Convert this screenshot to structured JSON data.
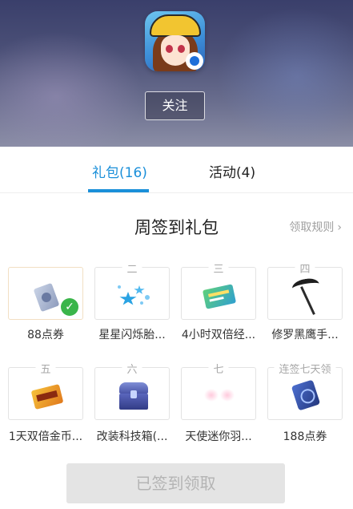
{
  "header": {
    "app_icon": "game-app-icon",
    "follow_label": "关注"
  },
  "tabs": [
    {
      "label": "礼包(16)",
      "active": true
    },
    {
      "label": "活动(4)",
      "active": false
    }
  ],
  "section": {
    "title": "周签到礼包",
    "rules_label": "领取规则",
    "rules_icon": "chevron-right-icon"
  },
  "gifts": [
    {
      "day": "",
      "name": "88点券",
      "icon": "coupon-icon",
      "claimed": true
    },
    {
      "day": "二",
      "name": "星星闪烁胎...",
      "icon": "stars-icon",
      "claimed": false
    },
    {
      "day": "三",
      "name": "4小时双倍经...",
      "icon": "ticket-icon",
      "claimed": false
    },
    {
      "day": "四",
      "name": "修罗黑鹰手...",
      "icon": "scythe-icon",
      "claimed": false
    },
    {
      "day": "五",
      "name": "1天双倍金币...",
      "icon": "gold-ticket-icon",
      "claimed": false
    },
    {
      "day": "六",
      "name": "改装科技箱(...",
      "icon": "chest-icon",
      "claimed": false
    },
    {
      "day": "七",
      "name": "天使迷你羽...",
      "icon": "wings-icon",
      "claimed": false
    },
    {
      "day": "连签七天领",
      "name": "188点券",
      "icon": "coupon-icon",
      "claimed": false
    }
  ],
  "claim_button": {
    "label": "已签到领取",
    "enabled": false
  },
  "colors": {
    "accent": "#1a8fd9",
    "check": "#3ab54a",
    "disabled_bg": "#e4e4e4"
  }
}
